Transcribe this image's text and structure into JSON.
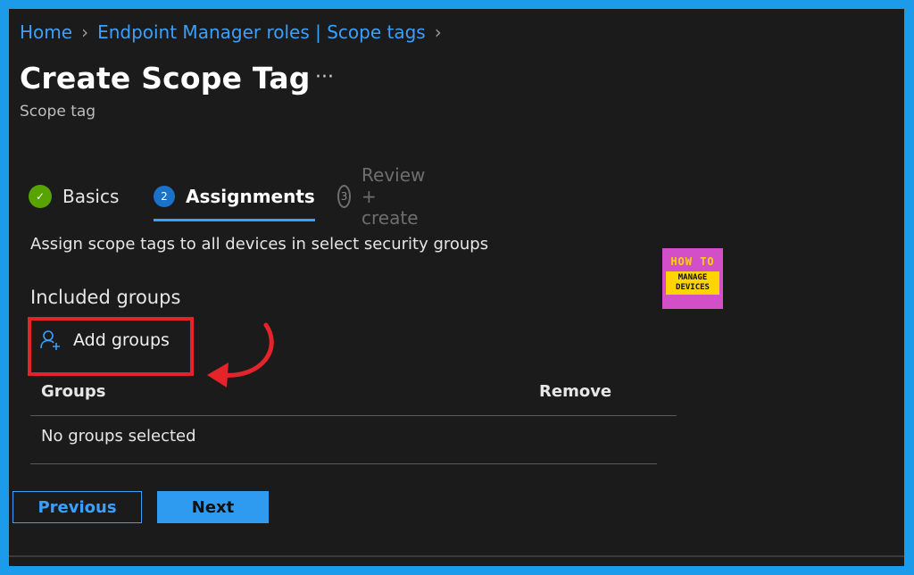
{
  "breadcrumb": {
    "home": "Home",
    "section": "Endpoint Manager roles | Scope tags"
  },
  "header": {
    "title": "Create Scope Tag",
    "more": "···",
    "subtitle": "Scope tag"
  },
  "tabs": [
    {
      "label": "Basics",
      "marker": "✓",
      "state": "completed"
    },
    {
      "label": "Assignments",
      "marker": "2",
      "state": "active"
    },
    {
      "label": "Review + create",
      "marker": "3",
      "state": "disabled"
    }
  ],
  "main": {
    "description": "Assign scope tags to all devices in select security groups",
    "section_title": "Included groups",
    "add_groups_label": "Add groups",
    "table": {
      "headers": [
        "Groups",
        "Remove"
      ],
      "empty_text": "No groups selected"
    }
  },
  "footer": {
    "previous_label": "Previous",
    "next_label": "Next"
  },
  "watermark": {
    "line1": "HOW TO",
    "line2a": "MANAGE",
    "line2b": "DEVICES"
  },
  "colors": {
    "accent": "#3aa0ff",
    "highlight": "#e3242b",
    "success": "#57a300",
    "background": "#1b1b1b",
    "frame": "#1b9be9"
  }
}
